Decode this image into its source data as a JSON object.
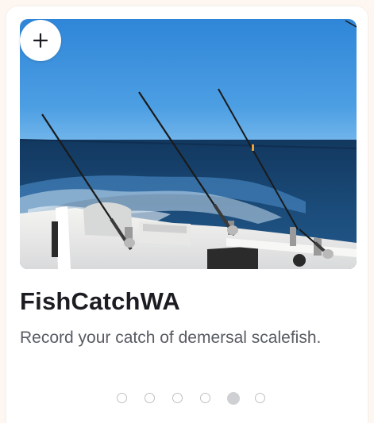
{
  "card": {
    "add_icon": "plus-icon",
    "title": "FishCatchWA",
    "description": "Record your catch of demersal scalefish.",
    "image_description": "fishing-rods-on-boat-at-sea-photo"
  },
  "carousel": {
    "count": 6,
    "active_index": 4
  },
  "colors": {
    "background": "#fdf6f1",
    "card": "#ffffff",
    "title": "#1b1d22",
    "description": "#585c63",
    "dot_inactive": "#bfc0c3",
    "dot_active": "#cfd0d3"
  }
}
